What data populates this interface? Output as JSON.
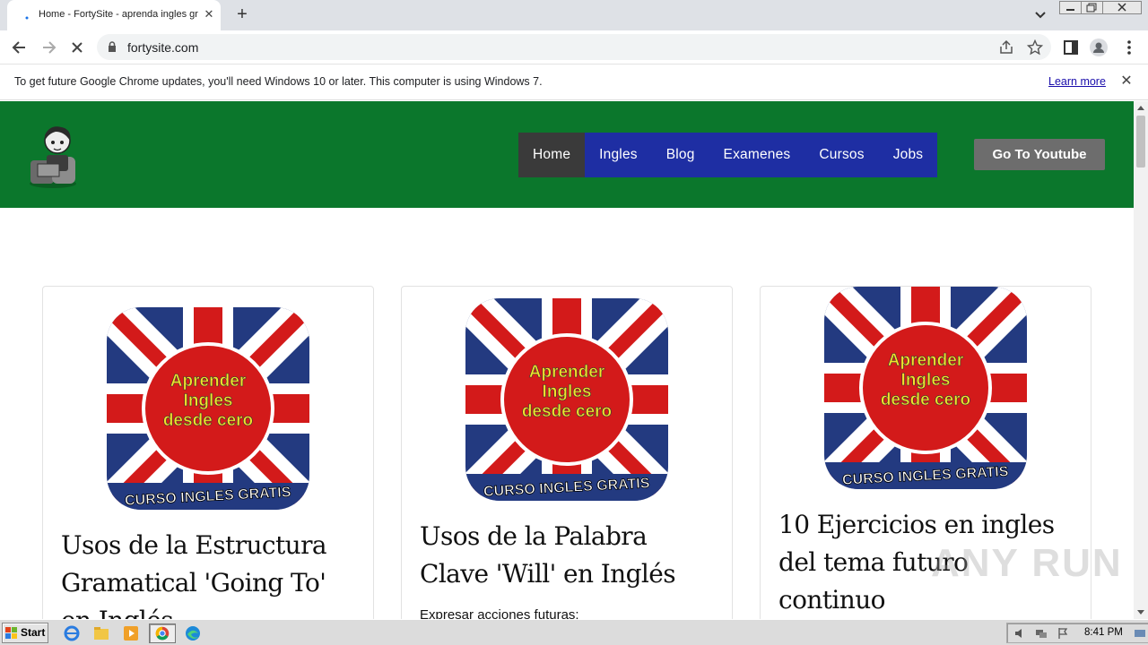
{
  "browser": {
    "tab_title": "Home - FortySite - aprenda ingles gr",
    "url": "fortysite.com",
    "infobar_text": "To get future Google Chrome updates, you'll need Windows 10 or later. This computer is using Windows 7.",
    "learn_more": "Learn more"
  },
  "site": {
    "nav": [
      {
        "label": "Home",
        "active": true
      },
      {
        "label": "Ingles"
      },
      {
        "label": "Blog"
      },
      {
        "label": "Examenes"
      },
      {
        "label": "Cursos"
      },
      {
        "label": "Jobs"
      }
    ],
    "youtube_button": "Go To Youtube",
    "cards": [
      {
        "title": "Usos de la Estructura Gramatical 'Going To' en Inglés",
        "excerpt": "",
        "image": {
          "line1": "Aprender",
          "line2": "Ingles",
          "line3": "desde cero",
          "banner": "CURSO INGLES GRATIS"
        }
      },
      {
        "title": "Usos de la Palabra Clave 'Will' en Inglés",
        "excerpt": "Expresar acciones futuras:",
        "image": {
          "line1": "Aprender",
          "line2": "Ingles",
          "line3": "desde cero",
          "banner": "CURSO INGLES GRATIS"
        }
      },
      {
        "title": "10 Ejercicios en ingles del tema futuro continuo",
        "excerpt": "",
        "image": {
          "line1": "Aprender",
          "line2": "Ingles",
          "line3": "desde cero",
          "banner": "CURSO INGLES GRATIS"
        }
      }
    ],
    "colors": {
      "header": "#0b772c",
      "nav": "#1e2ea3",
      "nav_active": "#3a3a3a",
      "button": "#6d6d6d"
    }
  },
  "watermark": "ANY RUN",
  "taskbar": {
    "start_label": "Start",
    "apps": [
      "ie-icon",
      "explorer-icon",
      "media-player-icon",
      "chrome-icon",
      "edge-icon"
    ],
    "clock": "8:41 PM"
  }
}
